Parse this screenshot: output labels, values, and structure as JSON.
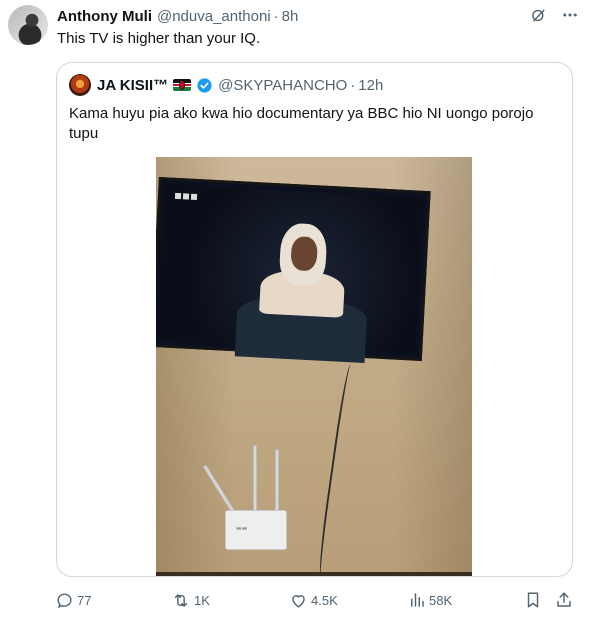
{
  "post": {
    "author_name": "Anthony Muli",
    "author_handle": "@nduva_anthoni",
    "separator": "·",
    "time": "8h",
    "text": "This TV is higher than your IQ."
  },
  "quoted": {
    "author_name": "JA KISII™",
    "author_handle": "@SKYPAHANCHO",
    "separator": "·",
    "time": "12h",
    "text": "Kama huyu pia ako kwa hio documentary ya BBC hio NI uongo  porojo tupu",
    "media_icons": [
      "kenya-flag-icon",
      "verified-badge-icon"
    ]
  },
  "actions": {
    "replies": "77",
    "reposts": "1K",
    "likes": "4.5K",
    "views": "58K"
  },
  "icons": {
    "top": [
      "grok-icon",
      "more-icon"
    ],
    "action_bar": [
      "reply-icon",
      "repost-icon",
      "like-icon",
      "views-icon",
      "bookmark-icon",
      "share-icon"
    ]
  },
  "colors": {
    "text": "#0f1419",
    "secondary": "#536471",
    "border": "#cfd9de",
    "verified": "#1d9bf0"
  }
}
